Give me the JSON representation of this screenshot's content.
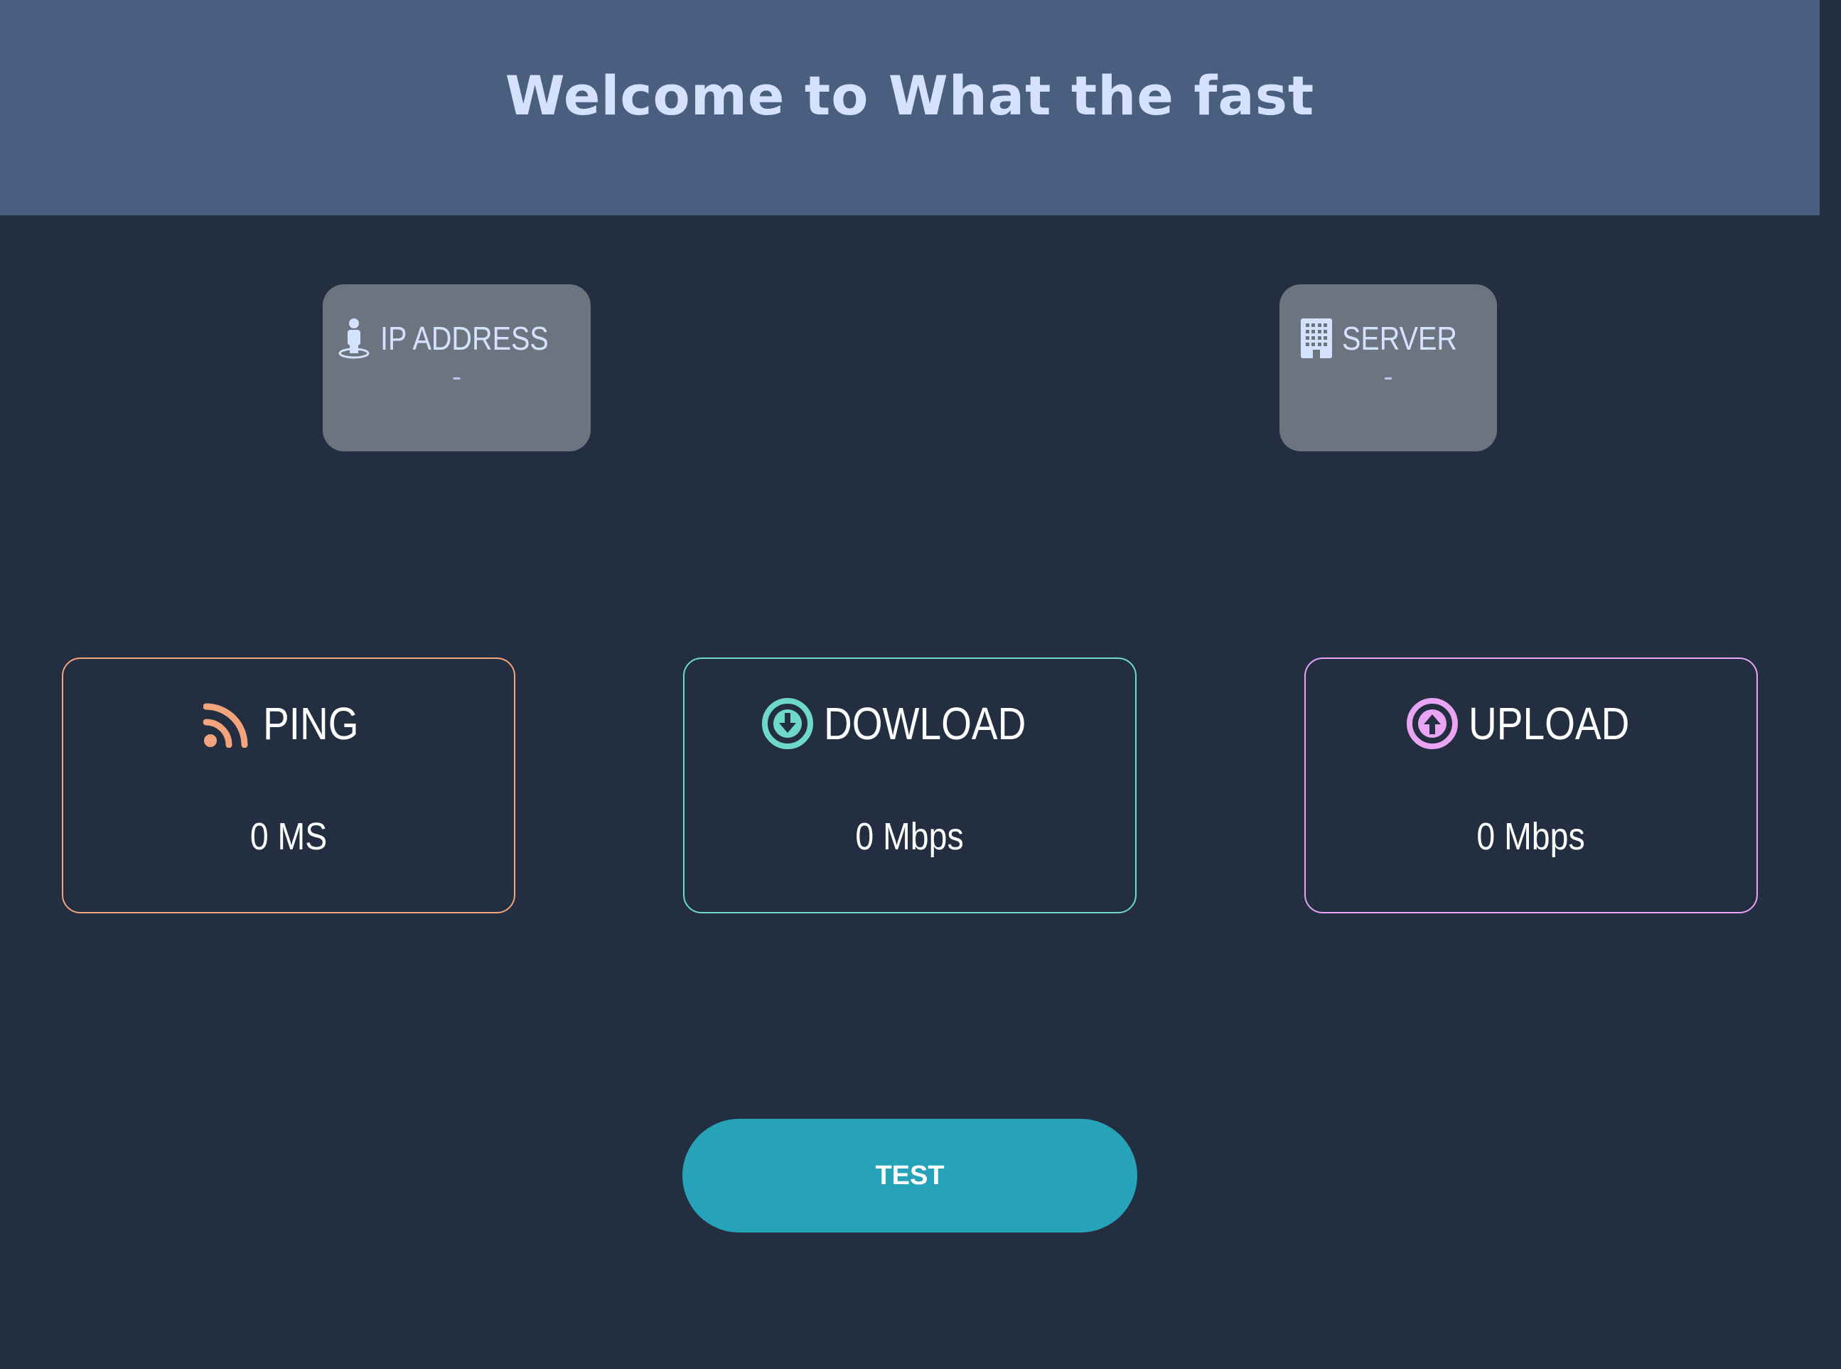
{
  "header": {
    "title": "Welcome to What the fast"
  },
  "info": {
    "ip": {
      "label": "IP ADDRESS",
      "value": "-",
      "icon": "person-pin-icon"
    },
    "server": {
      "label": "SERVER",
      "value": "-",
      "icon": "building-icon"
    }
  },
  "metrics": {
    "ping": {
      "label": "PING",
      "value": "0 MS",
      "icon": "rss-icon",
      "color": "#f4a47c"
    },
    "download": {
      "label": "DOWLOAD",
      "value": "0 Mbps",
      "icon": "arrow-down-circle-icon",
      "color": "#6fd9c7"
    },
    "upload": {
      "label": "UPLOAD",
      "value": "0 Mbps",
      "icon": "arrow-up-circle-icon",
      "color": "#e9a4f4"
    }
  },
  "actions": {
    "test_label": "TEST"
  },
  "colors": {
    "background": "#232f41",
    "header": "#4a5e80",
    "button": "#26a3b8"
  }
}
